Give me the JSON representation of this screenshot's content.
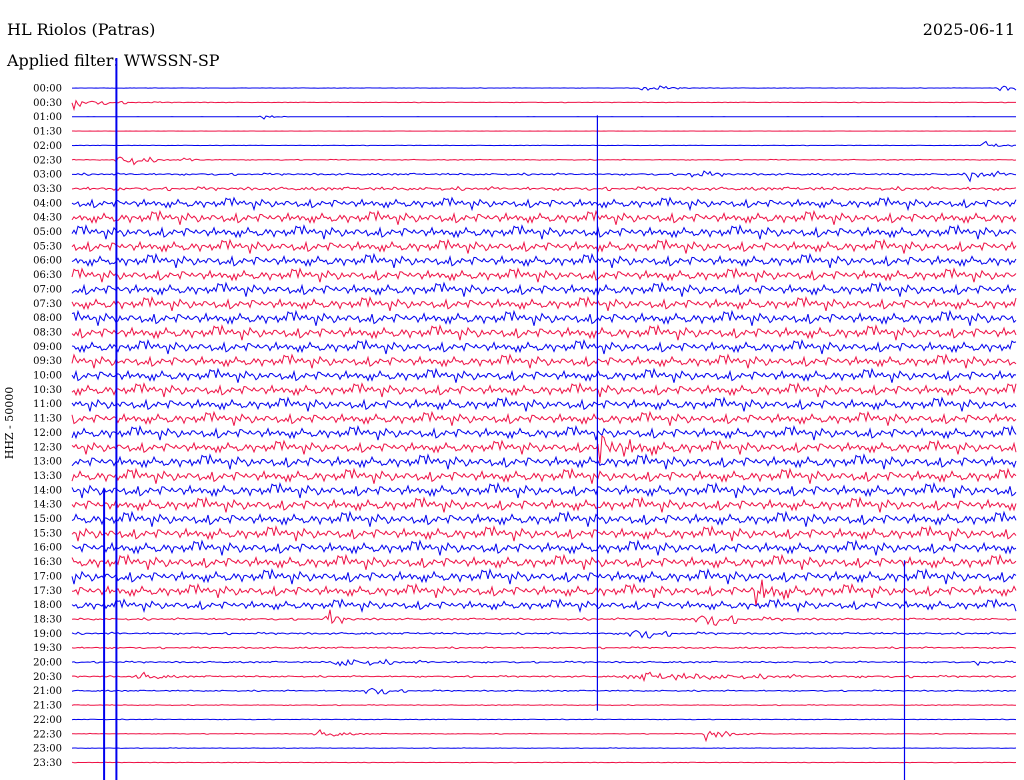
{
  "header": {
    "station": "HL Riolos (Patras)",
    "date": "2025-06-11",
    "filter_label": "Applied filter:",
    "filter_value": "WWSSN-SP"
  },
  "chart_data": {
    "type": "line",
    "title": "HL Riolos (Patras)",
    "subtitle": "Applied filter: WWSSN-SP",
    "date": "2025-06-11",
    "ylabel": "HHZ - 50000",
    "xlabel": "",
    "channel": "HHZ",
    "scale": 50000,
    "grid": false,
    "legend": "none",
    "colors": {
      "even_row": "#0000ee",
      "odd_row": "#ee1145"
    },
    "rows": [
      "00:00",
      "00:30",
      "01:00",
      "01:30",
      "02:00",
      "02:30",
      "03:00",
      "03:30",
      "04:00",
      "04:30",
      "05:00",
      "05:30",
      "06:00",
      "06:30",
      "07:00",
      "07:30",
      "08:00",
      "08:30",
      "09:00",
      "09:30",
      "10:00",
      "10:30",
      "11:00",
      "11:30",
      "12:00",
      "12:30",
      "13:00",
      "13:30",
      "14:00",
      "14:30",
      "15:00",
      "15:30",
      "16:00",
      "16:30",
      "17:00",
      "17:30",
      "18:00",
      "18:30",
      "19:00",
      "19:30",
      "20:00",
      "20:30",
      "21:00",
      "21:30",
      "22:00",
      "22:30",
      "23:00",
      "23:30"
    ],
    "noise_level": [
      0.25,
      0.4,
      0.12,
      0.1,
      0.3,
      0.6,
      1.5,
      2.5,
      6,
      7,
      7,
      7,
      7,
      7,
      7,
      7,
      7.5,
      7.5,
      7,
      7,
      7,
      7,
      7,
      7,
      7,
      7,
      7.5,
      7.5,
      7.5,
      7.5,
      7.5,
      7.5,
      7.5,
      7.5,
      7.5,
      7,
      6,
      1.5,
      1.5,
      1.2,
      1.2,
      1.2,
      1,
      0.6,
      0.5,
      0.5,
      0.4,
      0.4
    ],
    "events": [
      {
        "row": 0,
        "pos": 0.6,
        "amp": 9,
        "width": 0.02
      },
      {
        "row": 0,
        "pos": 0.98,
        "amp": 14,
        "width": 0.012
      },
      {
        "row": 1,
        "pos": 0.0,
        "amp": 9,
        "width": 0.03
      },
      {
        "row": 2,
        "pos": 0.2,
        "amp": 5,
        "width": 0.01
      },
      {
        "row": 4,
        "pos": 0.965,
        "amp": 8,
        "width": 0.015
      },
      {
        "row": 5,
        "pos": 0.05,
        "amp": 14,
        "width": 0.02
      },
      {
        "row": 5,
        "pos": 0.12,
        "amp": 4,
        "width": 0.01
      },
      {
        "row": 6,
        "pos": 0.65,
        "amp": 8,
        "width": 0.02
      },
      {
        "row": 6,
        "pos": 0.95,
        "amp": 10,
        "width": 0.02
      },
      {
        "row": 25,
        "pos": 0.555,
        "amp": 24,
        "width": 0.03
      },
      {
        "row": 35,
        "pos": 0.72,
        "amp": 22,
        "width": 0.02
      },
      {
        "row": 37,
        "pos": 0.27,
        "amp": 18,
        "width": 0.01
      },
      {
        "row": 37,
        "pos": 0.66,
        "amp": 16,
        "width": 0.03
      },
      {
        "row": 38,
        "pos": 0.59,
        "amp": 16,
        "width": 0.02
      },
      {
        "row": 40,
        "pos": 0.28,
        "amp": 8,
        "width": 0.04
      },
      {
        "row": 40,
        "pos": 0.96,
        "amp": 9,
        "width": 0.01
      },
      {
        "row": 41,
        "pos": 0.07,
        "amp": 10,
        "width": 0.015
      },
      {
        "row": 41,
        "pos": 0.6,
        "amp": 7,
        "width": 0.1
      },
      {
        "row": 42,
        "pos": 0.31,
        "amp": 16,
        "width": 0.015
      },
      {
        "row": 45,
        "pos": 0.26,
        "amp": 8,
        "width": 0.02
      },
      {
        "row": 45,
        "pos": 0.67,
        "amp": 16,
        "width": 0.015
      }
    ],
    "spikes": [
      {
        "pos": 0.047,
        "from_row": 0,
        "to_row": 47
      },
      {
        "pos": 0.034,
        "from_row": 30,
        "to_row": 47
      },
      {
        "pos": 0.556,
        "from_row": 4,
        "to_row": 42
      },
      {
        "pos": 0.881,
        "from_row": 35,
        "to_row": 47
      }
    ]
  }
}
